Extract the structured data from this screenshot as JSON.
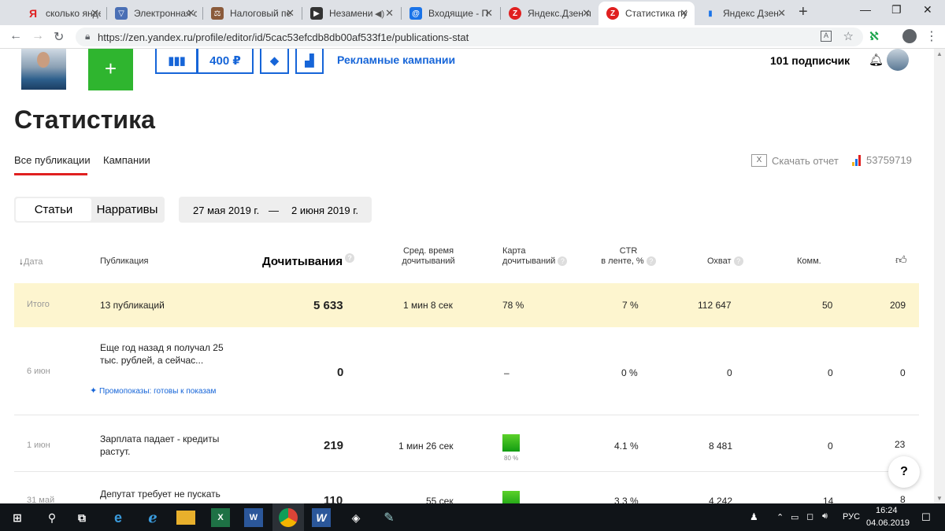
{
  "browser": {
    "tabs": [
      {
        "title": "сколько яндекс",
        "fav": "Я",
        "fav_color": "#ffffff",
        "fav_text": "#e02020"
      },
      {
        "title": "Электронная с",
        "fav": "▽",
        "fav_color": "#4a6fb5",
        "fav_text": "#ffffff"
      },
      {
        "title": "Налоговый пе",
        "fav": "⚖",
        "fav_color": "#8a5a3a",
        "fav_text": "#ffffff"
      },
      {
        "title": "Незамени",
        "fav": "▶",
        "fav_color": "#333333",
        "fav_text": "#ffffff"
      },
      {
        "title": "Входящие - П",
        "fav": "@",
        "fav_color": "#1a73e8",
        "fav_text": "#ffffff"
      },
      {
        "title": "Яндекс.Дзен п",
        "fav": "Z",
        "fav_color": "#e02020",
        "fav_text": "#ffffff"
      },
      {
        "title": "Статистика пу",
        "fav": "Z",
        "fav_color": "#e02020",
        "fav_text": "#ffffff"
      },
      {
        "title": "Яндекс Дзен -",
        "fav": "▮",
        "fav_color": "#f2b51d",
        "fav_text": "#1a73e8"
      }
    ],
    "active_tab": 6,
    "new_tab": "+",
    "url": "https://zen.yandex.ru/profile/editor/id/5cac53efcdb8db00af533f1e/publications-stat"
  },
  "toolbar": {
    "balance": "400 ₽",
    "ads_link": "Рекламные кампании",
    "subscribers": "101 подписчик",
    "add": "+"
  },
  "page": {
    "title": "Статистика",
    "tabs": [
      "Все публикации",
      "Кампании"
    ],
    "download": "Скачать отчет",
    "counter_id": "53759719",
    "segment": {
      "on": "Статьи",
      "off": "Нарративы"
    },
    "date_from": "27 мая 2019 г.",
    "date_sep": "—",
    "date_to": "2 июня 2019 г."
  },
  "table": {
    "headers": {
      "date": "Дата",
      "publication": "Публикация",
      "reads": "Дочитывания",
      "avg_time_1": "Сред. время",
      "avg_time_2": "дочитываний",
      "map_1": "Карта",
      "map_2": "дочитываний",
      "ctr_1": "CTR",
      "ctr_2": "в ленте, %",
      "reach": "Охват",
      "comments": "Комм."
    },
    "total": {
      "label": "Итого",
      "publications": "13 публикаций",
      "reads": "5 633",
      "avg_time": "1 мин 8 сек",
      "map": "78 %",
      "ctr": "7 %",
      "reach": "112 647",
      "comments": "50",
      "likes": "209"
    },
    "rows": [
      {
        "date": "6 июн",
        "title": "Еще год назад я получал 25 тыс. рублей, а сейчас...",
        "promo": "Промопоказы: готовы к показам",
        "reads": "0",
        "avg_time": "",
        "map": "–",
        "map_pct": "",
        "ctr": "0 %",
        "reach": "0",
        "comments": "0",
        "likes": "0"
      },
      {
        "date": "1 июн",
        "title": "Зарплата падает - кредиты растут.",
        "promo": "",
        "reads": "219",
        "avg_time": "1 мин 26 сек",
        "map": "",
        "map_pct": "80 %",
        "ctr": "4.1 %",
        "reach": "8 481",
        "comments": "0",
        "likes": "23"
      },
      {
        "date": "31 май",
        "title": "Депутат требует не пускать",
        "promo": "",
        "reads": "110",
        "avg_time": "55 сек",
        "map": "",
        "map_pct": "",
        "ctr": "3.3 %",
        "reach": "4 242",
        "comments": "14",
        "likes": "8"
      }
    ]
  },
  "help": "?",
  "taskbar": {
    "lang": "РУС",
    "time": "16:24",
    "date": "04.06.2019"
  },
  "colors": {
    "accent": "#1665d8",
    "green": "#2fb52f",
    "total_bg": "#fdf5cf",
    "red": "#e02020"
  }
}
